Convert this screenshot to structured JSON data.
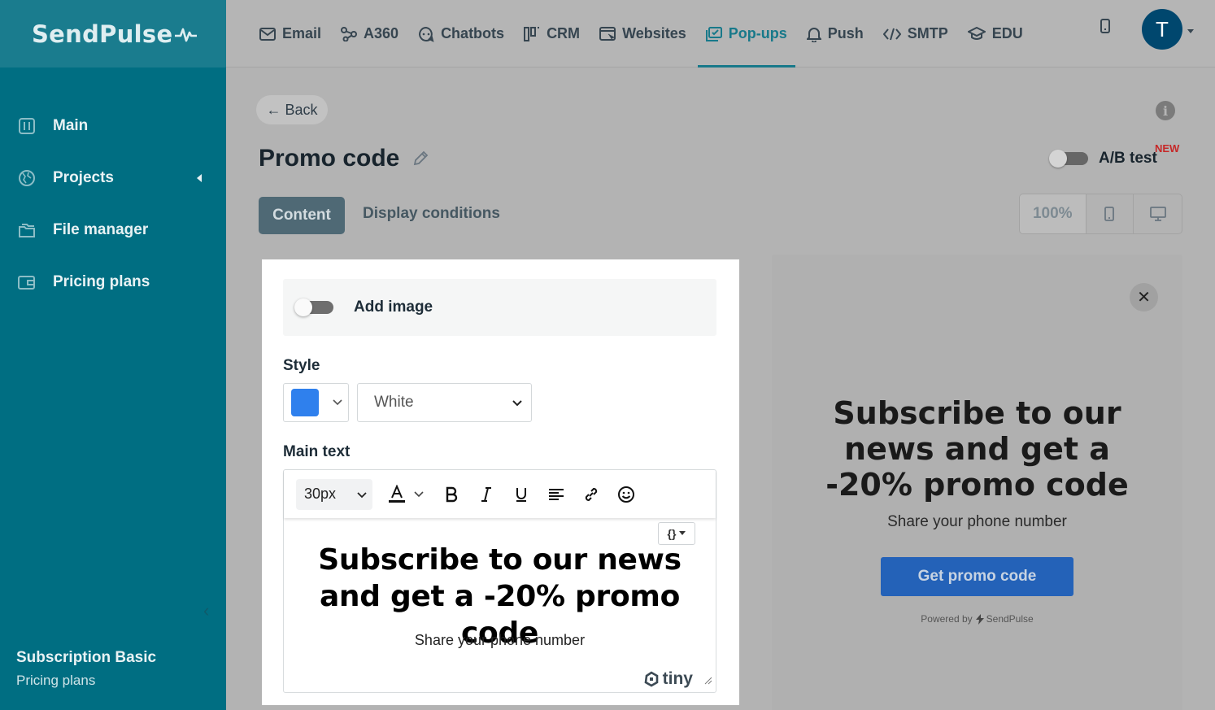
{
  "brand": {
    "name": "SendPulse"
  },
  "sidebar": {
    "items": [
      {
        "label": "Main",
        "icon": "dashboard-icon"
      },
      {
        "label": "Projects",
        "icon": "globe-icon"
      },
      {
        "label": "File manager",
        "icon": "folders-icon"
      },
      {
        "label": "Pricing plans",
        "icon": "wallet-icon"
      }
    ],
    "plan_name": "Subscription Basic",
    "plan_link": "Pricing plans"
  },
  "topnav": {
    "items": [
      {
        "label": "Email",
        "icon": "mail-icon"
      },
      {
        "label": "A360",
        "icon": "nodes-icon"
      },
      {
        "label": "Chatbots",
        "icon": "chat-icon"
      },
      {
        "label": "CRM",
        "icon": "kanban-icon"
      },
      {
        "label": "Websites",
        "icon": "browser-icon"
      },
      {
        "label": "Pop-ups",
        "icon": "popup-icon",
        "active": true
      },
      {
        "label": "Push",
        "icon": "bell-icon"
      },
      {
        "label": "SMTP",
        "icon": "code-icon"
      },
      {
        "label": "EDU",
        "icon": "graduation-icon"
      }
    ],
    "avatar_letter": "T"
  },
  "page": {
    "back_label": "← Back",
    "title": "Promo code",
    "ab_test_label": "A/B test",
    "ab_test_badge": "NEW",
    "tabs": {
      "content": "Content",
      "display_conditions": "Display conditions"
    },
    "zoom": "100%"
  },
  "editor": {
    "add_image_label": "Add image",
    "style_label": "Style",
    "style_color": "#2f80ed",
    "style_value": "White",
    "main_text_label": "Main text",
    "font_size": "30px",
    "code_chip": "{}",
    "headline": "Subscribe to our news and get a -20% promo code",
    "subline": "Share your phone number",
    "tiny_label": "tiny"
  },
  "preview": {
    "headline": "Subscribe to our news and get a -20% promo code",
    "subline": "Share your phone number",
    "button_label": "Get promo code",
    "powered_by": "Powered by",
    "powered_brand": "SendPulse"
  },
  "colors": {
    "sidebar": "#006e82",
    "accent": "#18798a",
    "cta": "#2462b8",
    "badge_new": "#c62828"
  }
}
